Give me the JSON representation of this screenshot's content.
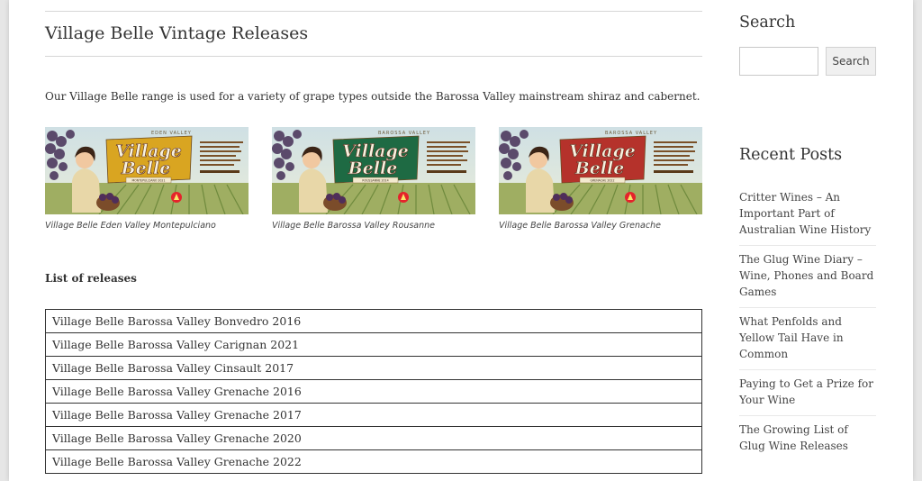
{
  "main": {
    "title": "Village Belle Vintage Releases",
    "intro": "Our Village Belle range is used for a variety of grape types outside the Barossa Valley mainstream shiraz and cabernet.",
    "labels": [
      {
        "caption": "Village Belle Eden Valley Montepulciano",
        "region": "EDEN VALLEY",
        "brand_line1": "Village",
        "brand_line2": "Belle",
        "banner_color": "#d9a521",
        "variety": "MONTEPULCIANO 2021"
      },
      {
        "caption": "Village Belle Barossa Valley Rousanne",
        "region": "BAROSSA VALLEY",
        "brand_line1": "Village",
        "brand_line2": "Belle",
        "banner_color": "#1e6a43",
        "variety": "ROUSSANNE 2014"
      },
      {
        "caption": "Village Belle Barossa Valley Grenache",
        "region": "BAROSSA VALLEY",
        "brand_line1": "Village",
        "brand_line2": "Belle",
        "banner_color": "#b5322b",
        "variety": "GRENACHE 2022"
      }
    ],
    "list_heading": "List of releases",
    "releases": [
      "Village Belle Barossa Valley Bonvedro 2016",
      "Village Belle Barossa Valley Carignan 2021",
      "Village Belle Barossa Valley Cinsault 2017",
      "Village Belle Barossa Valley Grenache 2016",
      "Village Belle Barossa Valley Grenache 2017",
      "Village Belle Barossa Valley Grenache 2020",
      "Village Belle Barossa Valley Grenache 2022"
    ]
  },
  "sidebar": {
    "search_title": "Search",
    "search_value": "",
    "search_button": "Search",
    "recent_title": "Recent Posts",
    "recent_posts": [
      "Critter Wines – An Important Part of Australian Wine History",
      "The Glug Wine Diary – Wine, Phones and Board Games",
      "What Penfolds and Yellow Tail Have in Common",
      "Paying to Get a Prize for Your Wine",
      "The Growing List of Glug Wine Releases"
    ]
  }
}
